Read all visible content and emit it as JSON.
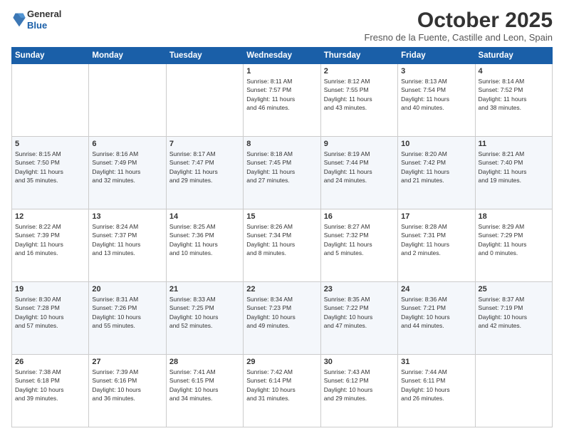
{
  "logo": {
    "general": "General",
    "blue": "Blue"
  },
  "header": {
    "month": "October 2025",
    "location": "Fresno de la Fuente, Castille and Leon, Spain"
  },
  "days_of_week": [
    "Sunday",
    "Monday",
    "Tuesday",
    "Wednesday",
    "Thursday",
    "Friday",
    "Saturday"
  ],
  "weeks": [
    [
      {
        "day": "",
        "info": ""
      },
      {
        "day": "",
        "info": ""
      },
      {
        "day": "",
        "info": ""
      },
      {
        "day": "1",
        "info": "Sunrise: 8:11 AM\nSunset: 7:57 PM\nDaylight: 11 hours\nand 46 minutes."
      },
      {
        "day": "2",
        "info": "Sunrise: 8:12 AM\nSunset: 7:55 PM\nDaylight: 11 hours\nand 43 minutes."
      },
      {
        "day": "3",
        "info": "Sunrise: 8:13 AM\nSunset: 7:54 PM\nDaylight: 11 hours\nand 40 minutes."
      },
      {
        "day": "4",
        "info": "Sunrise: 8:14 AM\nSunset: 7:52 PM\nDaylight: 11 hours\nand 38 minutes."
      }
    ],
    [
      {
        "day": "5",
        "info": "Sunrise: 8:15 AM\nSunset: 7:50 PM\nDaylight: 11 hours\nand 35 minutes."
      },
      {
        "day": "6",
        "info": "Sunrise: 8:16 AM\nSunset: 7:49 PM\nDaylight: 11 hours\nand 32 minutes."
      },
      {
        "day": "7",
        "info": "Sunrise: 8:17 AM\nSunset: 7:47 PM\nDaylight: 11 hours\nand 29 minutes."
      },
      {
        "day": "8",
        "info": "Sunrise: 8:18 AM\nSunset: 7:45 PM\nDaylight: 11 hours\nand 27 minutes."
      },
      {
        "day": "9",
        "info": "Sunrise: 8:19 AM\nSunset: 7:44 PM\nDaylight: 11 hours\nand 24 minutes."
      },
      {
        "day": "10",
        "info": "Sunrise: 8:20 AM\nSunset: 7:42 PM\nDaylight: 11 hours\nand 21 minutes."
      },
      {
        "day": "11",
        "info": "Sunrise: 8:21 AM\nSunset: 7:40 PM\nDaylight: 11 hours\nand 19 minutes."
      }
    ],
    [
      {
        "day": "12",
        "info": "Sunrise: 8:22 AM\nSunset: 7:39 PM\nDaylight: 11 hours\nand 16 minutes."
      },
      {
        "day": "13",
        "info": "Sunrise: 8:24 AM\nSunset: 7:37 PM\nDaylight: 11 hours\nand 13 minutes."
      },
      {
        "day": "14",
        "info": "Sunrise: 8:25 AM\nSunset: 7:36 PM\nDaylight: 11 hours\nand 10 minutes."
      },
      {
        "day": "15",
        "info": "Sunrise: 8:26 AM\nSunset: 7:34 PM\nDaylight: 11 hours\nand 8 minutes."
      },
      {
        "day": "16",
        "info": "Sunrise: 8:27 AM\nSunset: 7:32 PM\nDaylight: 11 hours\nand 5 minutes."
      },
      {
        "day": "17",
        "info": "Sunrise: 8:28 AM\nSunset: 7:31 PM\nDaylight: 11 hours\nand 2 minutes."
      },
      {
        "day": "18",
        "info": "Sunrise: 8:29 AM\nSunset: 7:29 PM\nDaylight: 11 hours\nand 0 minutes."
      }
    ],
    [
      {
        "day": "19",
        "info": "Sunrise: 8:30 AM\nSunset: 7:28 PM\nDaylight: 10 hours\nand 57 minutes."
      },
      {
        "day": "20",
        "info": "Sunrise: 8:31 AM\nSunset: 7:26 PM\nDaylight: 10 hours\nand 55 minutes."
      },
      {
        "day": "21",
        "info": "Sunrise: 8:33 AM\nSunset: 7:25 PM\nDaylight: 10 hours\nand 52 minutes."
      },
      {
        "day": "22",
        "info": "Sunrise: 8:34 AM\nSunset: 7:23 PM\nDaylight: 10 hours\nand 49 minutes."
      },
      {
        "day": "23",
        "info": "Sunrise: 8:35 AM\nSunset: 7:22 PM\nDaylight: 10 hours\nand 47 minutes."
      },
      {
        "day": "24",
        "info": "Sunrise: 8:36 AM\nSunset: 7:21 PM\nDaylight: 10 hours\nand 44 minutes."
      },
      {
        "day": "25",
        "info": "Sunrise: 8:37 AM\nSunset: 7:19 PM\nDaylight: 10 hours\nand 42 minutes."
      }
    ],
    [
      {
        "day": "26",
        "info": "Sunrise: 7:38 AM\nSunset: 6:18 PM\nDaylight: 10 hours\nand 39 minutes."
      },
      {
        "day": "27",
        "info": "Sunrise: 7:39 AM\nSunset: 6:16 PM\nDaylight: 10 hours\nand 36 minutes."
      },
      {
        "day": "28",
        "info": "Sunrise: 7:41 AM\nSunset: 6:15 PM\nDaylight: 10 hours\nand 34 minutes."
      },
      {
        "day": "29",
        "info": "Sunrise: 7:42 AM\nSunset: 6:14 PM\nDaylight: 10 hours\nand 31 minutes."
      },
      {
        "day": "30",
        "info": "Sunrise: 7:43 AM\nSunset: 6:12 PM\nDaylight: 10 hours\nand 29 minutes."
      },
      {
        "day": "31",
        "info": "Sunrise: 7:44 AM\nSunset: 6:11 PM\nDaylight: 10 hours\nand 26 minutes."
      },
      {
        "day": "",
        "info": ""
      }
    ]
  ]
}
